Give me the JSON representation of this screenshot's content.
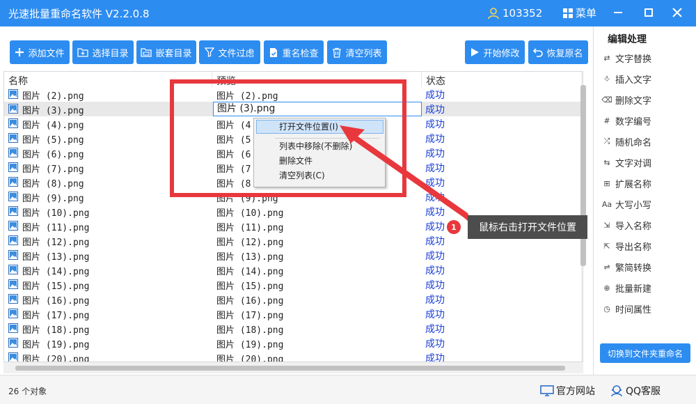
{
  "app": {
    "title": "光速批量重命名软件 V2.2.0.8",
    "user_id": "103352",
    "menu_label": "菜单",
    "accent_color": "#2d8cf0"
  },
  "toolbar": {
    "buttons": [
      {
        "label": "添加文件",
        "icon": "plus-icon"
      },
      {
        "label": "选择目录",
        "icon": "folder-plus-icon"
      },
      {
        "label": "嵌套目录",
        "icon": "folder-nested-icon"
      },
      {
        "label": "文件过虑",
        "icon": "funnel-icon"
      },
      {
        "label": "重名检查",
        "icon": "document-check-icon"
      },
      {
        "label": "清空列表",
        "icon": "trash-icon"
      },
      {
        "label": "开始修改",
        "icon": "play-icon"
      },
      {
        "label": "恢复原名",
        "icon": "undo-icon"
      }
    ]
  },
  "list": {
    "columns": [
      "名称",
      "预览",
      "状态"
    ],
    "rows": [
      {
        "name": "图片 (2).png",
        "preview": "图片 (2).png",
        "status": "成功"
      },
      {
        "name": "图片 (3).png",
        "preview": "图片 (3).png",
        "status": "成功"
      },
      {
        "name": "图片 (4).png",
        "preview": "图片 (4",
        "status": "成功"
      },
      {
        "name": "图片 (5).png",
        "preview": "图片 (5",
        "status": "成功"
      },
      {
        "name": "图片 (6).png",
        "preview": "图片 (6",
        "status": "成功"
      },
      {
        "name": "图片 (7).png",
        "preview": "图片 (7",
        "status": "成功"
      },
      {
        "name": "图片 (8).png",
        "preview": "图片 (8",
        "status": "成功"
      },
      {
        "name": "图片 (9).png",
        "preview": "图片 (9).png",
        "status": "成功"
      },
      {
        "name": "图片 (10).png",
        "preview": "图片 (10).png",
        "status": "成功"
      },
      {
        "name": "图片 (11).png",
        "preview": "图片 (11).png",
        "status": "成功"
      },
      {
        "name": "图片 (12).png",
        "preview": "图片 (12).png",
        "status": "成功"
      },
      {
        "name": "图片 (13).png",
        "preview": "图片 (13).png",
        "status": "成功"
      },
      {
        "name": "图片 (14).png",
        "preview": "图片 (14).png",
        "status": "成功"
      },
      {
        "name": "图片 (15).png",
        "preview": "图片 (15).png",
        "status": "成功"
      },
      {
        "name": "图片 (16).png",
        "preview": "图片 (16).png",
        "status": "成功"
      },
      {
        "name": "图片 (17).png",
        "preview": "图片 (17).png",
        "status": "成功"
      },
      {
        "name": "图片 (18).png",
        "preview": "图片 (18).png",
        "status": "成功"
      },
      {
        "name": "图片 (19).png",
        "preview": "图片 (19).png",
        "status": "成功"
      },
      {
        "name": "图片 (20).png",
        "preview": "图片 (20).png",
        "status": "成功"
      }
    ],
    "selected_row": 1,
    "edit_value": "图片 (3).png"
  },
  "context_menu": {
    "items": [
      "打开文件位置(I)",
      "列表中移除(不删除)",
      "删除文件",
      "清空列表(C)"
    ],
    "highlighted": 0
  },
  "annotation": {
    "badge": "1",
    "text": "鼠标右击打开文件位置"
  },
  "sidebar": {
    "title": "编辑处理",
    "items": [
      {
        "label": "文字替换",
        "icon": "replace-icon"
      },
      {
        "label": "插入文字",
        "icon": "insert-text-icon"
      },
      {
        "label": "删除文字",
        "icon": "delete-text-icon"
      },
      {
        "label": "数字编号",
        "icon": "numbering-icon"
      },
      {
        "label": "随机命名",
        "icon": "shuffle-icon"
      },
      {
        "label": "文字对调",
        "icon": "swap-icon"
      },
      {
        "label": "扩展名称",
        "icon": "extension-icon"
      },
      {
        "label": "大写小写",
        "icon": "case-icon"
      },
      {
        "label": "导入名称",
        "icon": "import-icon"
      },
      {
        "label": "导出名称",
        "icon": "export-icon"
      },
      {
        "label": "繁简转换",
        "icon": "convert-icon"
      },
      {
        "label": "批量新建",
        "icon": "batch-create-icon"
      },
      {
        "label": "时间属性",
        "icon": "clock-icon"
      }
    ],
    "switch_button": "切换到文件夹重命名"
  },
  "statusbar": {
    "count": "26 个对象",
    "links": [
      {
        "label": "官方网站",
        "icon": "monitor-icon"
      },
      {
        "label": "QQ客服",
        "icon": "headset-icon"
      }
    ]
  }
}
